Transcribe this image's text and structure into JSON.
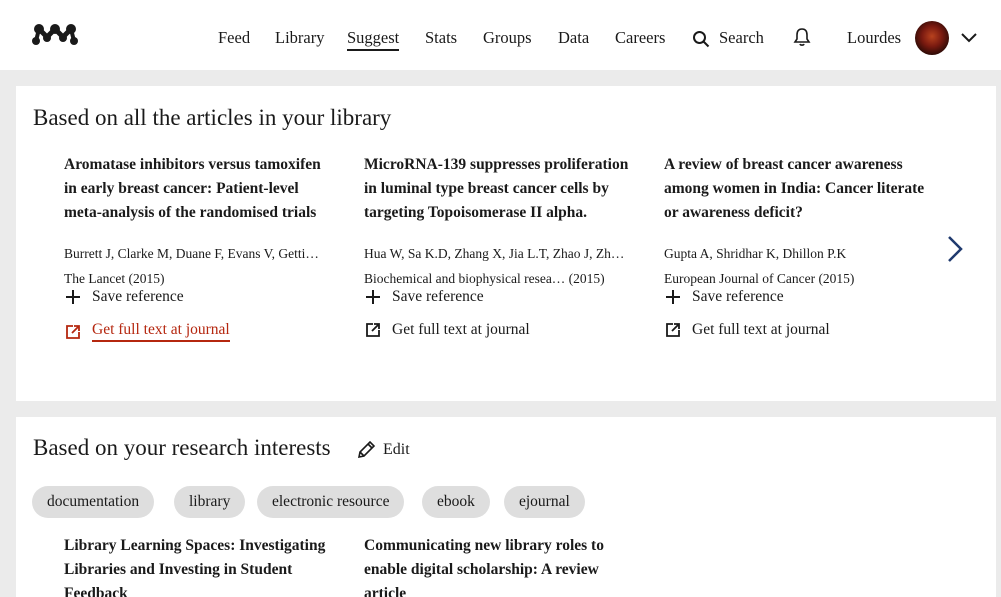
{
  "nav": {
    "items": [
      "Feed",
      "Library",
      "Suggest",
      "Stats",
      "Groups",
      "Data",
      "Careers"
    ],
    "active": "Suggest",
    "search_label": "Search",
    "user_name": "Lourdes"
  },
  "library_section": {
    "title": "Based on all the articles in your library",
    "articles": [
      {
        "title": "Aromatase inhibitors versus tamoxifen in early breast cancer: Patient-level meta-analysis of the randomised trials",
        "authors": "Burrett J, Clarke M, Duane F, Evans V, Getti…",
        "source": "The Lancet (2015)",
        "save_label": "Save reference",
        "fulltext_label": "Get full text at journal"
      },
      {
        "title": "MicroRNA-139 suppresses proliferation in luminal type breast cancer cells by targeting Topoisomerase II alpha.",
        "authors": "Hua W, Sa K.D, Zhang X, Jia L.T, Zhao J, Zh…",
        "source": "Biochemical and biophysical resea…  (2015)",
        "save_label": "Save reference",
        "fulltext_label": "Get full text at journal"
      },
      {
        "title": "A review of breast cancer awareness among women in India: Cancer literate or awareness deficit?",
        "authors": "Gupta A, Shridhar K, Dhillon P.K",
        "source": "European Journal of Cancer (2015)",
        "save_label": "Save reference",
        "fulltext_label": "Get full text at journal"
      }
    ]
  },
  "interests_section": {
    "title": "Based on your research interests",
    "edit_label": "Edit",
    "chips": [
      "documentation",
      "library",
      "electronic resource",
      "ebook",
      "ejournal"
    ],
    "articles": [
      {
        "title": "Library Learning Spaces: Investigating Libraries and Investing in Student Feedback"
      },
      {
        "title": "Communicating new library roles to enable digital scholarship: A review article"
      }
    ]
  },
  "colors": {
    "accent_link": "#b5270f",
    "page_bg": "#ebebeb",
    "chip_bg": "#dedede",
    "arrow": "#1f3a6e"
  },
  "icons": [
    "mendeley-logo-icon",
    "search-icon",
    "bell-icon",
    "chevron-down-icon",
    "plus-icon",
    "external-link-icon",
    "chevron-right-icon",
    "pencil-icon"
  ]
}
